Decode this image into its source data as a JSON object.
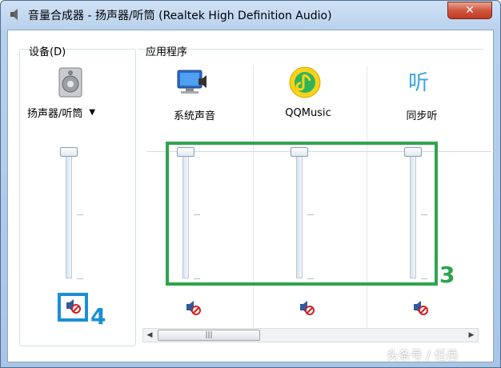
{
  "window": {
    "title": "音量合成器 - 扬声器/听筒 (Realtek High Definition Audio)",
    "close_label": "✕"
  },
  "device": {
    "group_label": "设备(D)",
    "name": "扬声器/听筒",
    "icon": "speaker-device-icon",
    "muted": true
  },
  "apps": {
    "group_label": "应用程序",
    "items": [
      {
        "name": "系统声音",
        "icon": "system-sounds-icon",
        "muted": true
      },
      {
        "name": "QQMusic",
        "icon": "qqmusic-icon",
        "muted": true
      },
      {
        "name": "同步听",
        "icon": "tongbuting-icon",
        "muted": true
      }
    ]
  },
  "annotations": {
    "box3_label": "3",
    "box4_label": "4",
    "box3_color": "#2ea44f",
    "box4_color": "#1a8fd6"
  },
  "scrollbar": {
    "thumb_grip": "|||"
  },
  "watermark": "头条号 / 任岳"
}
